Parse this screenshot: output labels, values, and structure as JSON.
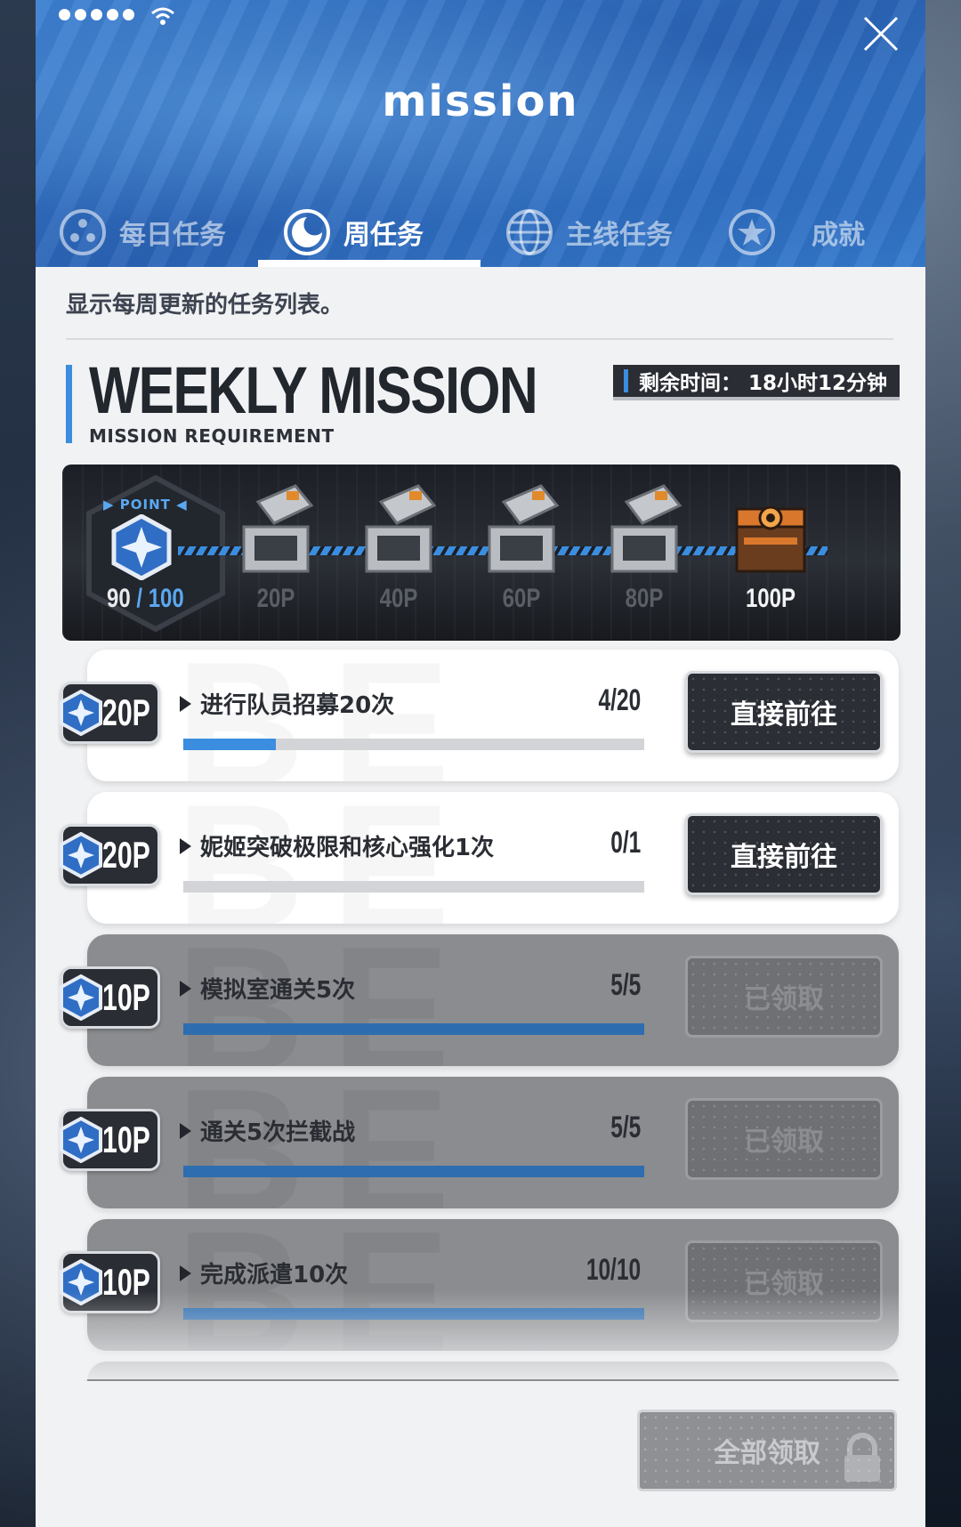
{
  "header": {
    "title": "mission",
    "close_icon": "close-icon",
    "status_icons": [
      "signal-dots-icon",
      "wifi-icon"
    ]
  },
  "tabs": [
    {
      "label": "每日任务",
      "icon": "daily-dots-icon",
      "active": false
    },
    {
      "label": "周任务",
      "icon": "moon-clock-icon",
      "active": true
    },
    {
      "label": "主线任务",
      "icon": "globe-icon",
      "active": false
    },
    {
      "label": "成就",
      "icon": "star-medal-icon",
      "active": false
    }
  ],
  "description": "显示每周更新的任务列表。",
  "weekly": {
    "title": "WEEKLY MISSION",
    "subtitle": "MISSION REQUIREMENT",
    "time_remaining": "剩余时间：  18小时12分钟"
  },
  "progress": {
    "point_label": "▶ POINT ◀",
    "current": "90",
    "separator": " / ",
    "max": "100",
    "milestones": [
      "20P",
      "40P",
      "60P",
      "80P",
      "100P"
    ],
    "accent_color": "#3b8de0"
  },
  "missions": [
    {
      "points": "20P",
      "title": "进行队员招募20次",
      "count": "4/20",
      "progress": 0.2,
      "button": "直接前往",
      "completed": false
    },
    {
      "points": "20P",
      "title": "妮姬突破极限和核心强化1次",
      "count": "0/1",
      "progress": 0.0,
      "button": "直接前往",
      "completed": false
    },
    {
      "points": "10P",
      "title": "模拟室通关5次",
      "count": "5/5",
      "progress": 1.0,
      "button": "已领取",
      "completed": true
    },
    {
      "points": "10P",
      "title": "通关5次拦截战",
      "count": "5/5",
      "progress": 1.0,
      "button": "已领取",
      "completed": true
    },
    {
      "points": "10P",
      "title": "完成派遣10次",
      "count": "10/10",
      "progress": 1.0,
      "button": "已领取",
      "completed": true
    }
  ],
  "footer": {
    "claim_all": "全部领取",
    "lock_icon": "lock-icon"
  }
}
